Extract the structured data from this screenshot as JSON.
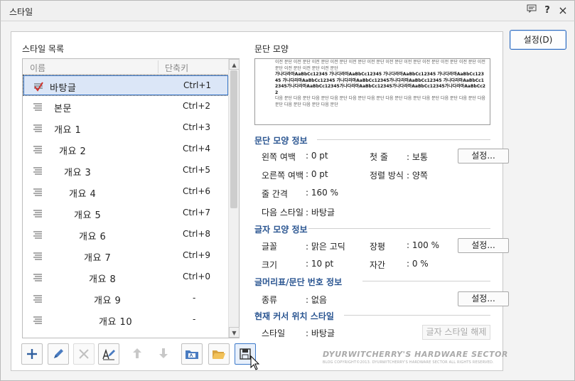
{
  "window": {
    "title": "스타일",
    "controls": [
      "help-icon",
      "close-icon"
    ],
    "help_label": "?",
    "close_label": "×"
  },
  "setup_button": "설정(D)",
  "style_list": {
    "label": "스타일 목록",
    "col_name": "이름",
    "col_key": "단축키",
    "items": [
      {
        "name": "바탕글",
        "key": "Ctrl+1",
        "indent": 0
      },
      {
        "name": "본문",
        "key": "Ctrl+2",
        "indent": 1
      },
      {
        "name": "개요 1",
        "key": "Ctrl+3",
        "indent": 1
      },
      {
        "name": "개요 2",
        "key": "Ctrl+4",
        "indent": 2
      },
      {
        "name": "개요 3",
        "key": "Ctrl+5",
        "indent": 3
      },
      {
        "name": "개요 4",
        "key": "Ctrl+6",
        "indent": 4
      },
      {
        "name": "개요 5",
        "key": "Ctrl+7",
        "indent": 5
      },
      {
        "name": "개요 6",
        "key": "Ctrl+8",
        "indent": 6
      },
      {
        "name": "개요 7",
        "key": "Ctrl+9",
        "indent": 7
      },
      {
        "name": "개요 8",
        "key": "Ctrl+0",
        "indent": 8
      },
      {
        "name": "개요 9",
        "key": "-",
        "indent": 9
      },
      {
        "name": "개요 10",
        "key": "-",
        "indent": 10
      }
    ],
    "selected_index": 0
  },
  "toolbar": {
    "add_icon": "plus-icon",
    "edit_icon": "pencil-icon",
    "delete_icon": "x-icon",
    "edit_style_icon": "edit-style-icon",
    "up_icon": "arrow-up-icon",
    "down_icon": "arrow-down-icon",
    "import_icon": "import-icon",
    "open_icon": "folder-open-icon",
    "save_icon": "save-icon"
  },
  "preview": {
    "label": "문단 모양",
    "lines_before": "이전 문단 이전 문단 이전 문단 이전 문단 이전 문단 이전 문단 이전 문단 이전 문단 이전 문단 이전 문단 이전 문단 이전 문단 이전 문단 이전 문단 이전 문단",
    "sample": "가나다라마AaBbCc12345 가나다라마AaBbCc12345 가나다라마AaBbCc12345 가나다라마AaBbCc12345 가나다라마AaBbCc12345 가나다라마AaBbCc12345가나다라마AaBbCc12345 가나다라마AaBbCc12345가나다라마AaBbCc12345가나다라마AaBbCc12345가나다라마AaBbCc12345가나다라마AaBbCc22",
    "lines_after": "다음 문단 다음 문단 다음 문단 다음 문단 다음 문단 다음 문단 다음 문단 다음 문단 다음 문단 다음 문단 다음 문단 다음 문단 다음 문단 다음 문단 다음 문단"
  },
  "paragraph_info": {
    "header": "문단 모양 정보",
    "left_margin_label": "왼쪽 여백",
    "left_margin": ": 0 pt",
    "first_line_label": "첫 줄",
    "first_line": ": 보통",
    "right_margin_label": "오른쪽 여백",
    "right_margin": ": 0 pt",
    "align_label": "정렬 방식",
    "align": ": 양쪽",
    "line_spacing_label": "줄 간격",
    "line_spacing": ": 160 %",
    "next_style_label": "다음 스타일",
    "next_style": ": 바탕글",
    "settings": "설정..."
  },
  "char_info": {
    "header": "글자 모양 정보",
    "font_label": "글꼴",
    "font": ": 맑은 고딕",
    "ratio_label": "장평",
    "ratio": ": 100 %",
    "size_label": "크기",
    "size": ": 10 pt",
    "spacing_label": "자간",
    "spacing": ": 0 %",
    "settings": "설정..."
  },
  "numbering_info": {
    "header": "글머리표/문단 번호 정보",
    "type_label": "종류",
    "type": ": 없음",
    "settings": "설정..."
  },
  "cursor_info": {
    "header": "현재 커서 위치 스타일",
    "style_label": "스타일",
    "style": ": 바탕글",
    "release_button": "글자 스타일 해제"
  },
  "watermark": {
    "title": "DYURWITCHERRY'S HARDWARE SECTOR",
    "sub": "BLOG COPYRIGHT©2013. DYURWITCHERRY'S HARDWARE SECTOR ALL RIGHTS RESERVED."
  }
}
